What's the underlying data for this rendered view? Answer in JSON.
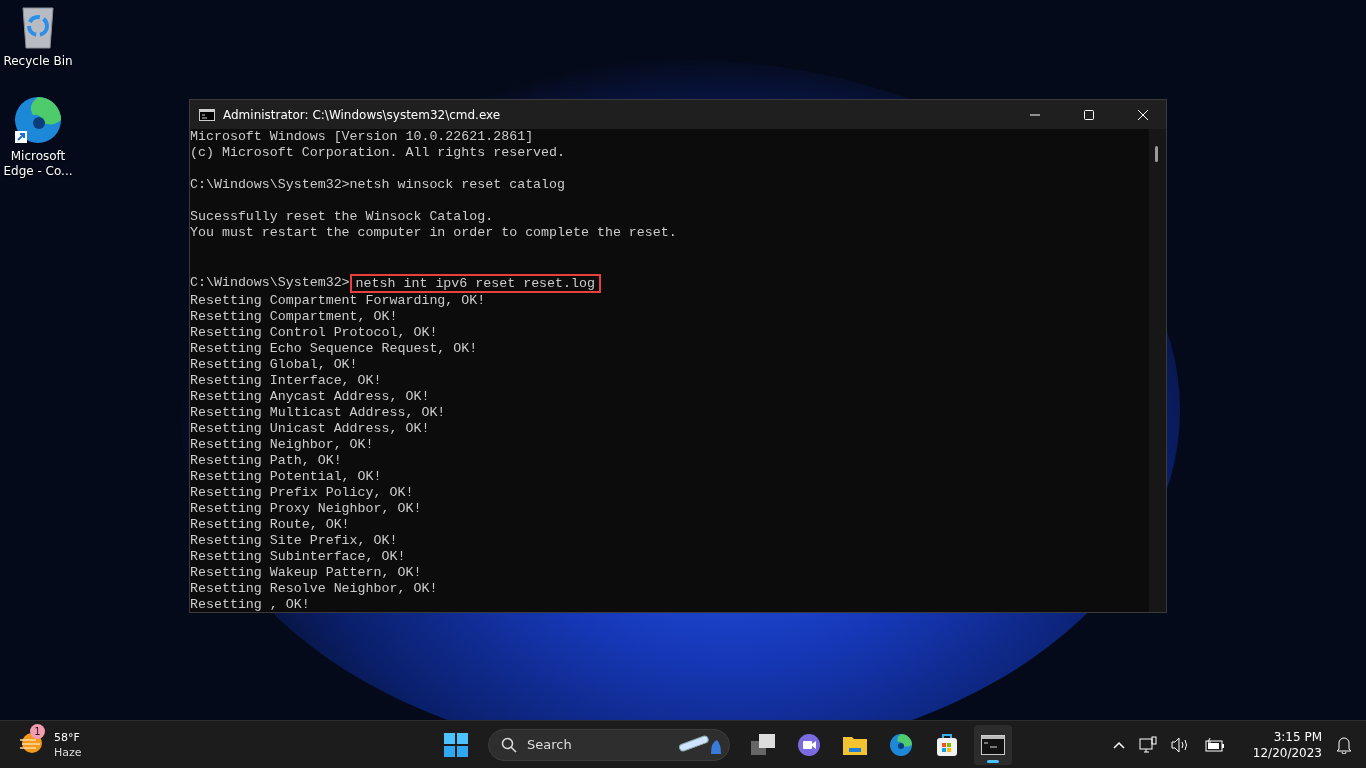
{
  "desktop_icons": [
    {
      "kind": "recycle",
      "label": "Recycle Bin"
    },
    {
      "kind": "edge",
      "label": "Microsoft Edge - Co..."
    }
  ],
  "window": {
    "title": "Administrator: C:\\Windows\\system32\\cmd.exe",
    "lines": [
      {
        "kind": "output",
        "text": "Microsoft Windows [Version 10.0.22621.2861]"
      },
      {
        "kind": "output",
        "text": "(c) Microsoft Corporation. All rights reserved."
      },
      {
        "kind": "blank"
      },
      {
        "kind": "prompt",
        "prompt": "C:\\Windows\\System32>",
        "command": "netsh winsock reset catalog",
        "highlighted": false
      },
      {
        "kind": "blank"
      },
      {
        "kind": "output",
        "text": "Sucessfully reset the Winsock Catalog."
      },
      {
        "kind": "output",
        "text": "You must restart the computer in order to complete the reset."
      },
      {
        "kind": "blank"
      },
      {
        "kind": "blank"
      },
      {
        "kind": "prompt",
        "prompt": "C:\\Windows\\System32>",
        "command": "netsh int ipv6 reset reset.log",
        "highlighted": true
      },
      {
        "kind": "output",
        "text": "Resetting Compartment Forwarding, OK!"
      },
      {
        "kind": "output",
        "text": "Resetting Compartment, OK!"
      },
      {
        "kind": "output",
        "text": "Resetting Control Protocol, OK!"
      },
      {
        "kind": "output",
        "text": "Resetting Echo Sequence Request, OK!"
      },
      {
        "kind": "output",
        "text": "Resetting Global, OK!"
      },
      {
        "kind": "output",
        "text": "Resetting Interface, OK!"
      },
      {
        "kind": "output",
        "text": "Resetting Anycast Address, OK!"
      },
      {
        "kind": "output",
        "text": "Resetting Multicast Address, OK!"
      },
      {
        "kind": "output",
        "text": "Resetting Unicast Address, OK!"
      },
      {
        "kind": "output",
        "text": "Resetting Neighbor, OK!"
      },
      {
        "kind": "output",
        "text": "Resetting Path, OK!"
      },
      {
        "kind": "output",
        "text": "Resetting Potential, OK!"
      },
      {
        "kind": "output",
        "text": "Resetting Prefix Policy, OK!"
      },
      {
        "kind": "output",
        "text": "Resetting Proxy Neighbor, OK!"
      },
      {
        "kind": "output",
        "text": "Resetting Route, OK!"
      },
      {
        "kind": "output",
        "text": "Resetting Site Prefix, OK!"
      },
      {
        "kind": "output",
        "text": "Resetting Subinterface, OK!"
      },
      {
        "kind": "output",
        "text": "Resetting Wakeup Pattern, OK!"
      },
      {
        "kind": "output",
        "text": "Resetting Resolve Neighbor, OK!"
      },
      {
        "kind": "output",
        "text": "Resetting , OK!"
      }
    ]
  },
  "taskbar": {
    "weather": {
      "badge": "1",
      "temperature": "58°F",
      "condition": "Haze"
    },
    "search": {
      "placeholder": "Search"
    },
    "apps": [
      {
        "kind": "taskview",
        "active": false
      },
      {
        "kind": "meet",
        "active": false
      },
      {
        "kind": "explorer",
        "active": false
      },
      {
        "kind": "edge",
        "active": false
      },
      {
        "kind": "store",
        "active": false
      },
      {
        "kind": "terminal",
        "active": true
      }
    ],
    "time": "3:15 PM",
    "date": "12/20/2023"
  }
}
